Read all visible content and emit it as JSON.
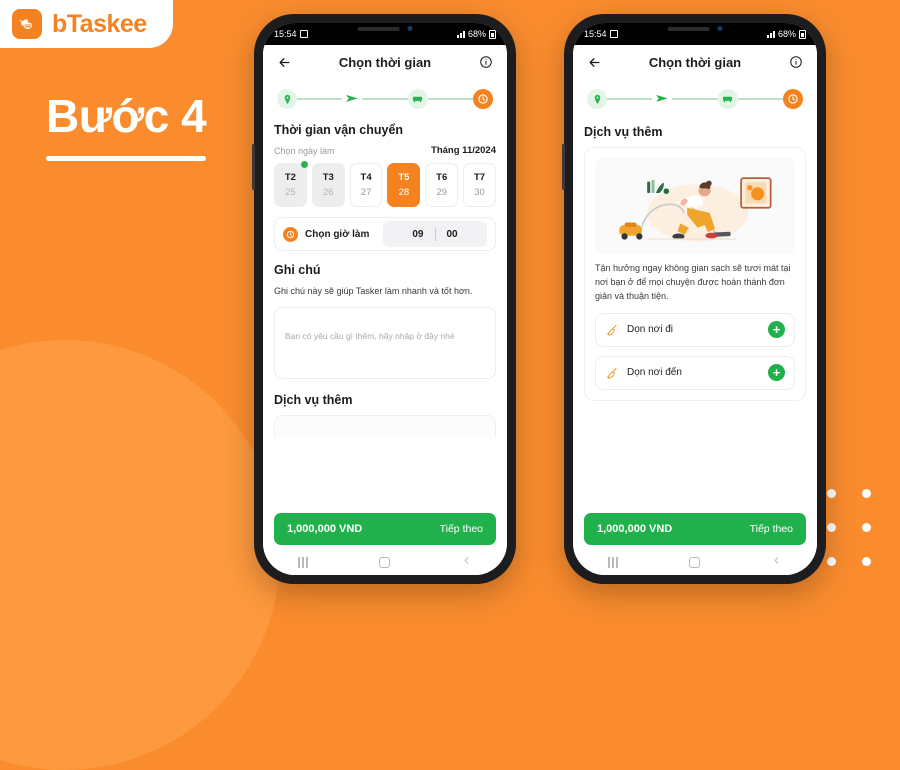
{
  "brand": {
    "name": "bTaskee",
    "logo_icon": "bee-icon",
    "accent_orange": "#F5821F",
    "accent_green": "#21B14C",
    "background_orange": "#FA8C2E"
  },
  "promo": {
    "step_label": "Bước 4",
    "underline": true
  },
  "status_bar": {
    "time": "15:54",
    "screenshot_icon": "screenshot-icon",
    "signal_icon": "signal-icon",
    "battery_text": "68%",
    "battery_icon": "battery-icon"
  },
  "header": {
    "back_icon": "back-arrow-icon",
    "title": "Chọn thời gian",
    "info_icon": "info-circle-icon"
  },
  "stepper": {
    "steps": [
      {
        "icon": "location-pin-icon",
        "state": "done"
      },
      {
        "icon": "paper-plane-icon",
        "state": "done"
      },
      {
        "icon": "truck-icon",
        "state": "done"
      },
      {
        "icon": "clock-icon",
        "state": "active"
      }
    ]
  },
  "phone1": {
    "section_time": {
      "title": "Thời gian vận chuyển",
      "pick_day_label": "Chọn ngày làm",
      "month_label": "Tháng 11/2024",
      "days": [
        {
          "dow": "T2",
          "date": "25",
          "state": "disabled",
          "badge": true
        },
        {
          "dow": "T3",
          "date": "26",
          "state": "disabled",
          "badge": false
        },
        {
          "dow": "T4",
          "date": "27",
          "state": "normal",
          "badge": false
        },
        {
          "dow": "T5",
          "date": "28",
          "state": "selected",
          "badge": false
        },
        {
          "dow": "T6",
          "date": "29",
          "state": "normal",
          "badge": false
        },
        {
          "dow": "T7",
          "date": "30",
          "state": "normal",
          "badge": false
        }
      ],
      "time_picker": {
        "icon": "clock-icon",
        "label": "Chọn giờ làm",
        "hour": "09",
        "minute": "00"
      }
    },
    "section_note": {
      "title": "Ghi chú",
      "description": "Ghi chú này sẽ giúp Tasker làm nhanh và tốt hơn.",
      "placeholder": "Bạn có yêu cầu gì thêm, hãy nhập ở đây nhé",
      "value": ""
    },
    "section_extra": {
      "title": "Dịch vụ thêm"
    },
    "cta": {
      "price": "1,000,000 VND",
      "next_label": "Tiếp theo"
    }
  },
  "phone2": {
    "section_extra": {
      "title": "Dịch vụ thêm",
      "illustration": "person-vacuuming-illustration",
      "description": "Tận hưởng ngay không gian sạch sẽ tươi mát tại nơi bạn ở để mọi chuyện được hoàn thành đơn giản và thuận tiện.",
      "services": [
        {
          "icon": "broom-icon",
          "name": "Dọn nơi đi",
          "action_icon": "plus-icon",
          "action_label": "+"
        },
        {
          "icon": "broom-icon",
          "name": "Dọn nơi đến",
          "action_icon": "plus-icon",
          "action_label": "+"
        }
      ]
    },
    "cta": {
      "price": "1,000,000 VND",
      "next_label": "Tiếp theo"
    }
  },
  "nav_bar": {
    "recent_icon": "recents-icon",
    "home_icon": "home-icon",
    "back_icon": "back-icon"
  }
}
